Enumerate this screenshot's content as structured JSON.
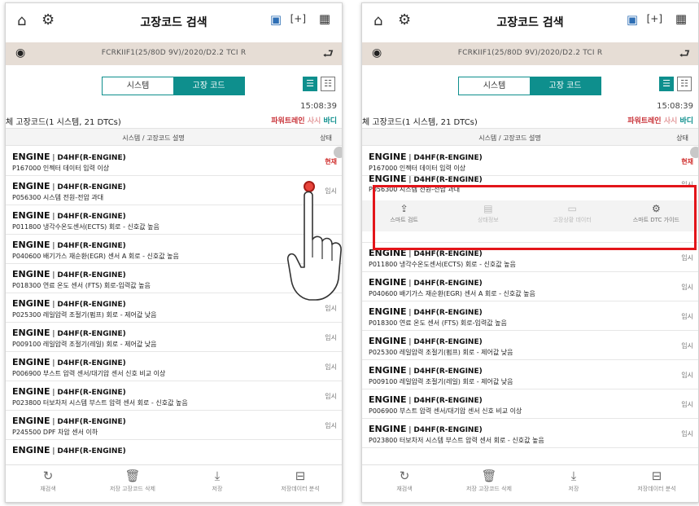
{
  "header": {
    "title": "고장코드 검색",
    "home_icon": "home-icon",
    "settings_icon": "vehicle-settings-icon",
    "vci_icon": "vci-status-icon",
    "capture_icon": "capture-icon",
    "menu_icon": "grid-menu-icon",
    "home_glyph": "⌂",
    "settings_glyph": "⚙",
    "vci_glyph": "▣",
    "capture_glyph": "[+]",
    "menu_glyph": "▦"
  },
  "vehicle": {
    "info": "FCRKIIF1(25/80D 9V)/2020/D2.2 TCI R",
    "icon_glyph": "◉",
    "back_glyph": "⮐"
  },
  "tabs": {
    "system": "시스템",
    "dtc": "고장 코드"
  },
  "view": {
    "list_glyph": "☰",
    "grid_glyph": "☷"
  },
  "list_header": {
    "time": "15:08:39",
    "summary": "체 고장코드(1 시스템, 21 DTCs)",
    "filter_powertrain": "파워트레인",
    "filter_temp": "사시",
    "filter_body": "바디",
    "col_desc": "시스템 / 고장코드 설명",
    "col_state": "상태"
  },
  "left_rows": [
    {
      "system": "ENGINE",
      "sub": "D4HF(R-ENGINE)",
      "code": "P167000 인젝터 데이터 입력 이상",
      "state": "현재"
    },
    {
      "system": "ENGINE",
      "sub": "D4HF(R-ENGINE)",
      "code": "P056300 시스템 전원-전압 과대",
      "state": "임시"
    },
    {
      "system": "ENGINE",
      "sub": "D4HF(R-ENGINE)",
      "code": "P011800 냉각수온도센서(ECTS) 회로 - 신호값 높음",
      "state": ""
    },
    {
      "system": "ENGINE",
      "sub": "D4HF(R-ENGINE)",
      "code": "P040600 배기가스 재순환(EGR) 센서 A 회로 - 신호값 높음",
      "state": ""
    },
    {
      "system": "ENGINE",
      "sub": "D4HF(R-ENGINE)",
      "code": "P018300 연료 온도 센서 (FTS) 회로-입력값 높음",
      "state": ""
    },
    {
      "system": "ENGINE",
      "sub": "D4HF(R-ENGINE)",
      "code": "P025300 레일압력 조절기(펌프) 회로 - 제어값 낮음",
      "state": "임시"
    },
    {
      "system": "ENGINE",
      "sub": "D4HF(R-ENGINE)",
      "code": "P009100 레일압력 조절기(레일) 회로 - 제어값 낮음",
      "state": "임시"
    },
    {
      "system": "ENGINE",
      "sub": "D4HF(R-ENGINE)",
      "code": "P006900 부스트 압력 센서/대기압 센서 신호 비교 이상",
      "state": "임시"
    },
    {
      "system": "ENGINE",
      "sub": "D4HF(R-ENGINE)",
      "code": "P023800 터보차저 시스템 부스트 압력 센서 회로 - 신호값 높음",
      "state": "임시"
    },
    {
      "system": "ENGINE",
      "sub": "D4HF(R-ENGINE)",
      "code": "P245500 DPF 차압 센서 이하",
      "state": "임시"
    },
    {
      "system": "ENGINE",
      "sub": "D4HF(R-ENGINE)",
      "code": "",
      "state": ""
    }
  ],
  "right_first": {
    "system": "ENGINE",
    "sub": "D4HF(R-ENGINE)",
    "code": "P167000 인젝터 데이터 입력 이상",
    "state": "현재"
  },
  "right_expanded": {
    "system": "ENGINE",
    "sub": "D4HF(R-ENGINE)",
    "code": "P056300 시스템 전원-전압 과대",
    "state": "임시"
  },
  "actions": [
    {
      "label": "스마트 검트",
      "icon": "share-icon",
      "glyph": "⇪"
    },
    {
      "label": "상태정보",
      "icon": "status-info-icon",
      "glyph": "▤"
    },
    {
      "label": "고장상황 데이터",
      "icon": "freeze-frame-icon",
      "glyph": "▭"
    },
    {
      "label": "스마트 DTC 가이드",
      "icon": "dtc-guide-icon",
      "glyph": "⚙"
    }
  ],
  "right_rows": [
    {
      "system": "ENGINE",
      "sub": "D4HF(R-ENGINE)",
      "code": "P011800 냉각수온도센서(ECTS) 회로 - 신호값 높음",
      "state": "임시"
    },
    {
      "system": "ENGINE",
      "sub": "D4HF(R-ENGINE)",
      "code": "P040600 배기가스 재순환(EGR) 센서 A 회로 - 신호값 높음",
      "state": "임시"
    },
    {
      "system": "ENGINE",
      "sub": "D4HF(R-ENGINE)",
      "code": "P018300 연료 온도 센서 (FTS) 회로-입력값 높음",
      "state": "임시"
    },
    {
      "system": "ENGINE",
      "sub": "D4HF(R-ENGINE)",
      "code": "P025300 레일압력 조절기(펌프) 회로 - 제어값 낮음",
      "state": "임시"
    },
    {
      "system": "ENGINE",
      "sub": "D4HF(R-ENGINE)",
      "code": "P009100 레일압력 조절기(레일) 회로 - 제어값 낮음",
      "state": "임시"
    },
    {
      "system": "ENGINE",
      "sub": "D4HF(R-ENGINE)",
      "code": "P006900 부스트 압력 센서/대기압 센서 신호 비교 이상",
      "state": "임시"
    },
    {
      "system": "ENGINE",
      "sub": "D4HF(R-ENGINE)",
      "code": "P023800 터보차저 시스템 부스트 압력 센서 회로 - 신호값 높음",
      "state": "임시"
    }
  ],
  "bottom": [
    {
      "label": "재검색",
      "icon": "refresh-icon",
      "glyph": "↻"
    },
    {
      "label": "저장 고장코드 삭제",
      "icon": "delete-icon",
      "glyph": "🗑"
    },
    {
      "label": "저장",
      "icon": "save-icon",
      "glyph": "⤓"
    },
    {
      "label": "저장데이터 분석",
      "icon": "data-analysis-icon",
      "glyph": "⊟"
    }
  ],
  "colors": {
    "accent": "#0e8f8d",
    "vehicle_bar": "#e6ddd5",
    "current_state": "#d0302f",
    "highlight": "#e3151a"
  }
}
